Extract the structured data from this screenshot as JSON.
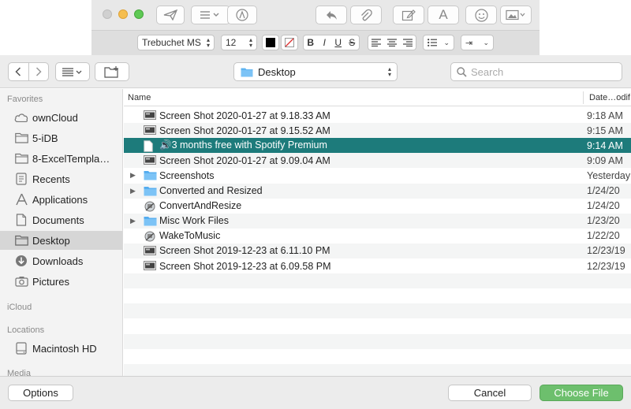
{
  "mail_toolbar": {
    "font_name": "Trebuchet MS",
    "font_size": "12",
    "bold": "B",
    "italic": "I",
    "underline": "U",
    "strike": "S",
    "font_icon_label": "A"
  },
  "dialog": {
    "location": "Desktop",
    "search_placeholder": "Search",
    "columns": {
      "name": "Name",
      "date": "Date…odif"
    },
    "sidebar": {
      "favorites_heading": "Favorites",
      "favorites": [
        {
          "label": "ownCloud",
          "icon": "cloud-icon"
        },
        {
          "label": "5-iDB",
          "icon": "folder-icon"
        },
        {
          "label": "8-ExcelTempla…",
          "icon": "folder-icon"
        },
        {
          "label": "Recents",
          "icon": "clock-icon"
        },
        {
          "label": "Applications",
          "icon": "applications-icon"
        },
        {
          "label": "Documents",
          "icon": "document-icon"
        },
        {
          "label": "Desktop",
          "icon": "desktop-icon"
        },
        {
          "label": "Downloads",
          "icon": "download-icon"
        },
        {
          "label": "Pictures",
          "icon": "camera-icon"
        }
      ],
      "icloud_heading": "iCloud",
      "locations_heading": "Locations",
      "locations": [
        {
          "label": "Macintosh HD",
          "icon": "hard-drive-icon"
        }
      ],
      "media_heading": "Media"
    },
    "files": [
      {
        "name": "Screen Shot 2020-01-27 at 9.18.33 AM",
        "date": "9:18 AM",
        "icon": "screenshot-icon"
      },
      {
        "name": "Screen Shot 2020-01-27 at 9.15.52 AM",
        "date": "9:15 AM",
        "icon": "screenshot-icon"
      },
      {
        "name": "🔊3 months free with Spotify Premium",
        "date": "9:14 AM",
        "icon": "document-icon"
      },
      {
        "name": "Screen Shot 2020-01-27 at 9.09.04 AM",
        "date": "9:09 AM",
        "icon": "screenshot-icon"
      },
      {
        "name": "Screenshots",
        "date": "Yesterday",
        "icon": "folder-icon"
      },
      {
        "name": "Converted and Resized",
        "date": "1/24/20",
        "icon": "folder-icon"
      },
      {
        "name": "ConvertAndResize",
        "date": "1/24/20",
        "icon": "automator-icon"
      },
      {
        "name": "Misc Work Files",
        "date": "1/23/20",
        "icon": "folder-icon"
      },
      {
        "name": "WakeToMusic",
        "date": "1/22/20",
        "icon": "automator-icon"
      },
      {
        "name": "Screen Shot 2019-12-23 at 6.11.10 PM",
        "date": "12/23/19",
        "icon": "screenshot-icon"
      },
      {
        "name": "Screen Shot 2019-12-23 at 6.09.58 PM",
        "date": "12/23/19",
        "icon": "screenshot-icon"
      }
    ],
    "options_label": "Options",
    "cancel_label": "Cancel",
    "choose_label": "Choose File"
  }
}
